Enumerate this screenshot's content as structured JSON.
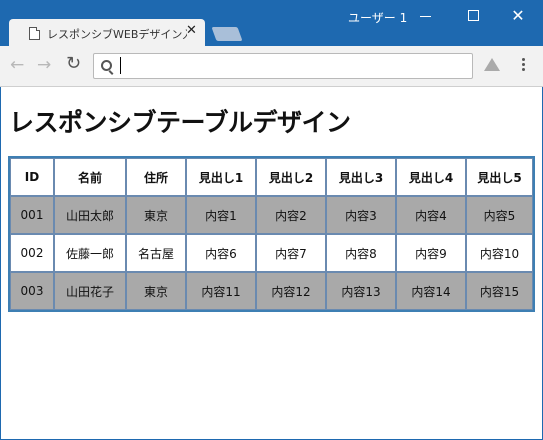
{
  "window": {
    "profile_name": "ユーザー 1",
    "minimize_label": "",
    "maximize_label": "",
    "close_label": "✕"
  },
  "tab": {
    "title": "レスポンシブWEBデザイン入門",
    "close_label": "✕"
  },
  "toolbar": {
    "back_label": "←",
    "forward_label": "→",
    "reload_label": "↻",
    "address_value": ""
  },
  "page": {
    "title": "レスポンシブテーブルデザイン",
    "table": {
      "headers": [
        "ID",
        "名前",
        "住所",
        "見出し1",
        "見出し2",
        "見出し3",
        "見出し4",
        "見出し5"
      ],
      "rows": [
        [
          "001",
          "山田太郎",
          "東京",
          "内容1",
          "内容2",
          "内容3",
          "内容4",
          "内容5"
        ],
        [
          "002",
          "佐藤一郎",
          "名古屋",
          "内容6",
          "内容7",
          "内容8",
          "内容9",
          "内容10"
        ],
        [
          "003",
          "山田花子",
          "東京",
          "内容11",
          "内容12",
          "内容13",
          "内容14",
          "内容15"
        ]
      ]
    }
  },
  "colors": {
    "titlebar": "#1e69b0",
    "table_border": "#3e7fb3",
    "shaded_row": "#a9a9a9"
  }
}
